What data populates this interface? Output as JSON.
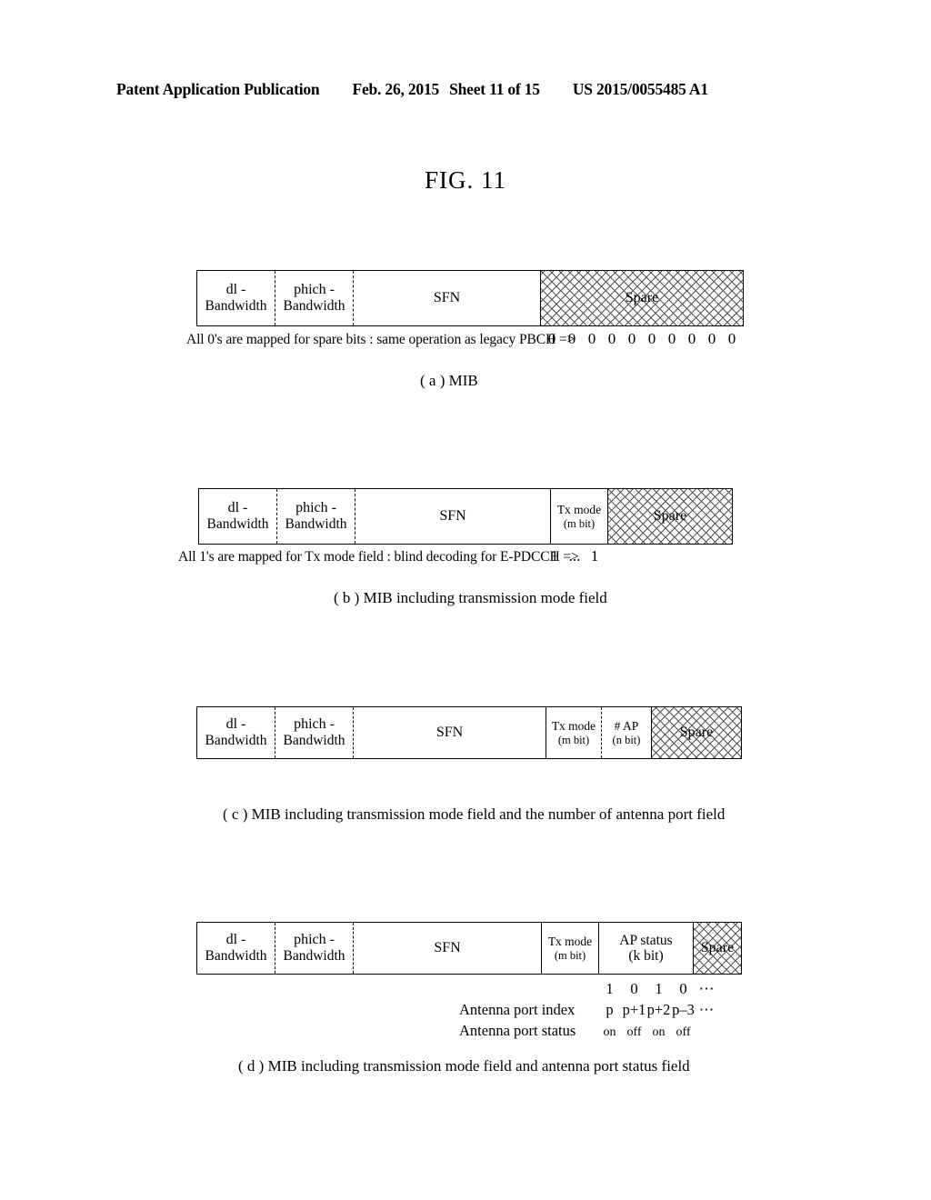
{
  "header": {
    "publication": "Patent Application Publication",
    "date": "Feb. 26, 2015",
    "sheet": "Sheet 11 of 15",
    "doc_number": "US 2015/0055485 A1"
  },
  "figure": {
    "title": "FIG. 11"
  },
  "fields": {
    "dl_bandwidth_l1": "dl -",
    "dl_bandwidth_l2": "Bandwidth",
    "phich_bandwidth_l1": "phich -",
    "phich_bandwidth_l2": "Bandwidth",
    "sfn": "SFN",
    "spare": "Spare",
    "tx_mode_l1": "Tx mode",
    "tx_mode_l2": "(m bit)",
    "num_ap_l1": "# AP",
    "num_ap_l2": "(n bit)",
    "ap_status_l1": "AP status",
    "ap_status_l2": "(k bit)"
  },
  "panel_a": {
    "caption": "( a ) MIB",
    "note": "All 0's are mapped for spare bits : same operation as legacy PBCH =>",
    "bits": [
      "0",
      "0",
      "0",
      "0",
      "0",
      "0",
      "0",
      "0",
      "0",
      "0"
    ]
  },
  "panel_b": {
    "caption": "( b ) MIB including transmission mode field",
    "note": "All 1's are mapped for Tx mode field : blind decoding for E-PDCCH =>",
    "bits": [
      "1",
      "...",
      "1"
    ]
  },
  "panel_c": {
    "caption": "( c ) MIB including transmission mode field and the number of antenna port field"
  },
  "panel_d": {
    "caption": "( d ) MIB including transmission mode field and antenna port status field",
    "bit_values": [
      "1",
      "0",
      "1",
      "0",
      "⋯"
    ],
    "index_label": "Antenna port index",
    "index_values": [
      "p",
      "p+1",
      "p+2",
      "p–3",
      "⋯"
    ],
    "status_label": "Antenna port status",
    "status_values": [
      "on",
      "off",
      "on",
      "off"
    ]
  }
}
